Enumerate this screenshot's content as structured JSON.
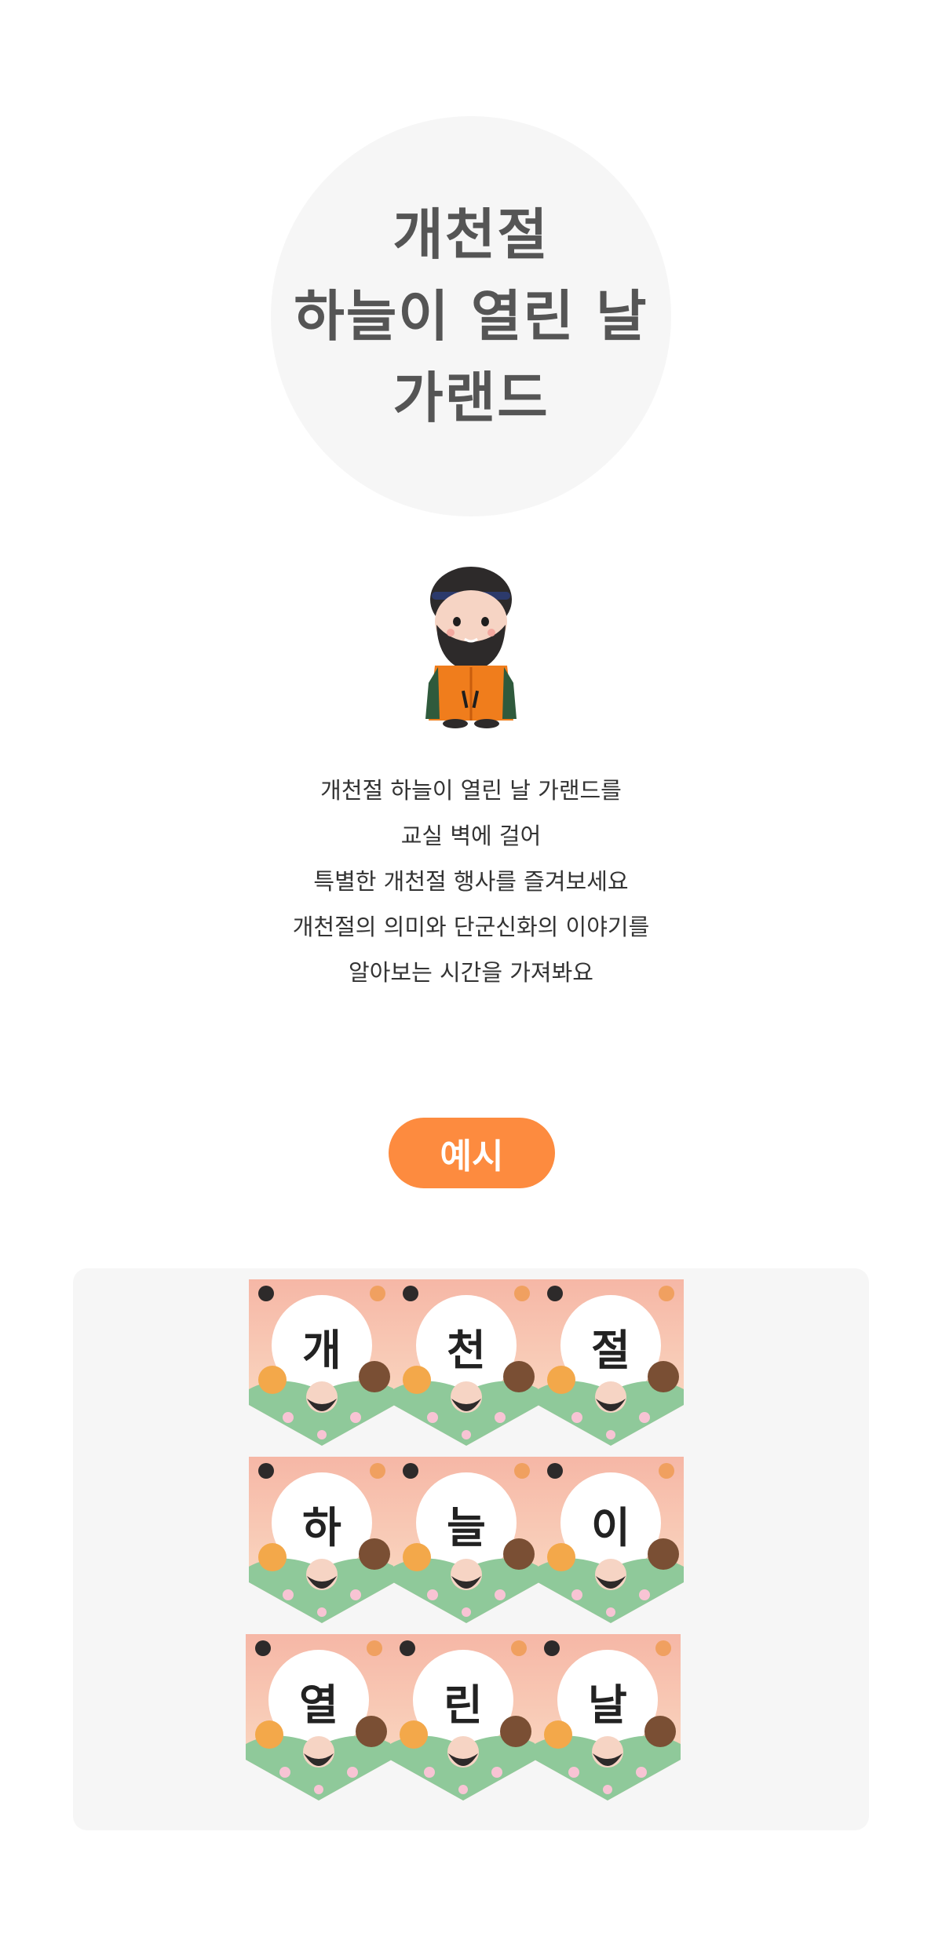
{
  "title": {
    "lines": [
      "개천절",
      "하늘이 열린 날",
      "가랜드"
    ]
  },
  "mascot": {
    "icon": "dangun-character-icon"
  },
  "description": {
    "lines": [
      "개천절 하늘이 열린 날 가랜드를",
      "교실 벽에 걸어",
      "특별한 개천절 행사를 즐겨보세요",
      "개천절의 의미와 단군신화의 이야기를",
      "알아보는 시간을 가져봐요"
    ]
  },
  "example": {
    "label": "예시"
  },
  "garland": {
    "flags": [
      "개",
      "천",
      "절",
      "하",
      "늘",
      "이",
      "열",
      "린",
      "날"
    ]
  },
  "colors": {
    "accent": "#fd8b3f",
    "panel_bg": "#f6f6f6",
    "title_text": "#555555",
    "flag_bg": "#f7c6b4"
  }
}
